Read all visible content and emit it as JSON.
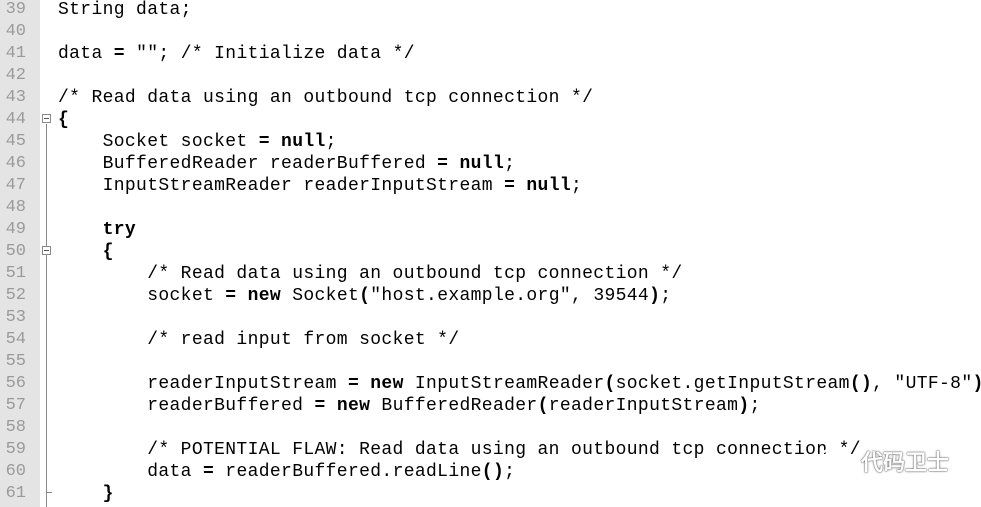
{
  "editor": {
    "lines": [
      {
        "num": "39",
        "segments": [
          {
            "t": "String data;",
            "c": "tx"
          }
        ]
      },
      {
        "num": "40",
        "segments": []
      },
      {
        "num": "41",
        "segments": [
          {
            "t": "data ",
            "c": "tx"
          },
          {
            "t": "=",
            "c": "op"
          },
          {
            "t": " \"\"; ",
            "c": "tx"
          },
          {
            "t": "/* Initialize data */",
            "c": "cm"
          }
        ]
      },
      {
        "num": "42",
        "segments": []
      },
      {
        "num": "43",
        "segments": [
          {
            "t": "/* Read data using an outbound tcp connection */",
            "c": "cm"
          }
        ]
      },
      {
        "num": "44",
        "segments": [
          {
            "t": "{",
            "c": "op"
          }
        ]
      },
      {
        "num": "45",
        "segments": [
          {
            "t": "    Socket socket ",
            "c": "tx"
          },
          {
            "t": "=",
            "c": "op"
          },
          {
            "t": " ",
            "c": "tx"
          },
          {
            "t": "null",
            "c": "kw"
          },
          {
            "t": ";",
            "c": "tx"
          }
        ]
      },
      {
        "num": "46",
        "segments": [
          {
            "t": "    BufferedReader readerBuffered ",
            "c": "tx"
          },
          {
            "t": "=",
            "c": "op"
          },
          {
            "t": " ",
            "c": "tx"
          },
          {
            "t": "null",
            "c": "kw"
          },
          {
            "t": ";",
            "c": "tx"
          }
        ]
      },
      {
        "num": "47",
        "segments": [
          {
            "t": "    InputStreamReader readerInputStream ",
            "c": "tx"
          },
          {
            "t": "=",
            "c": "op"
          },
          {
            "t": " ",
            "c": "tx"
          },
          {
            "t": "null",
            "c": "kw"
          },
          {
            "t": ";",
            "c": "tx"
          }
        ]
      },
      {
        "num": "48",
        "segments": []
      },
      {
        "num": "49",
        "segments": [
          {
            "t": "    ",
            "c": "tx"
          },
          {
            "t": "try",
            "c": "kw"
          }
        ]
      },
      {
        "num": "50",
        "segments": [
          {
            "t": "    ",
            "c": "tx"
          },
          {
            "t": "{",
            "c": "op"
          }
        ]
      },
      {
        "num": "51",
        "segments": [
          {
            "t": "        ",
            "c": "tx"
          },
          {
            "t": "/* Read data using an outbound tcp connection */",
            "c": "cm"
          }
        ]
      },
      {
        "num": "52",
        "segments": [
          {
            "t": "        socket ",
            "c": "tx"
          },
          {
            "t": "=",
            "c": "op"
          },
          {
            "t": " ",
            "c": "tx"
          },
          {
            "t": "new",
            "c": "kw"
          },
          {
            "t": " Socket",
            "c": "tx"
          },
          {
            "t": "(",
            "c": "op"
          },
          {
            "t": "\"host.example.org\", 39544",
            "c": "str"
          },
          {
            "t": ")",
            "c": "op"
          },
          {
            "t": ";",
            "c": "tx"
          }
        ]
      },
      {
        "num": "53",
        "segments": []
      },
      {
        "num": "54",
        "segments": [
          {
            "t": "        ",
            "c": "tx"
          },
          {
            "t": "/* read input from socket */",
            "c": "cm"
          }
        ]
      },
      {
        "num": "55",
        "segments": []
      },
      {
        "num": "56",
        "segments": [
          {
            "t": "        readerInputStream ",
            "c": "tx"
          },
          {
            "t": "=",
            "c": "op"
          },
          {
            "t": " ",
            "c": "tx"
          },
          {
            "t": "new",
            "c": "kw"
          },
          {
            "t": " InputStreamReader",
            "c": "tx"
          },
          {
            "t": "(",
            "c": "op"
          },
          {
            "t": "socket.getInputStream",
            "c": "tx"
          },
          {
            "t": "()",
            "c": "op"
          },
          {
            "t": ", \"UTF-8\"",
            "c": "str"
          },
          {
            "t": ")",
            "c": "op"
          },
          {
            "t": ";",
            "c": "tx"
          }
        ]
      },
      {
        "num": "57",
        "segments": [
          {
            "t": "        readerBuffered ",
            "c": "tx"
          },
          {
            "t": "=",
            "c": "op"
          },
          {
            "t": " ",
            "c": "tx"
          },
          {
            "t": "new",
            "c": "kw"
          },
          {
            "t": " BufferedReader",
            "c": "tx"
          },
          {
            "t": "(",
            "c": "op"
          },
          {
            "t": "readerInputStream",
            "c": "tx"
          },
          {
            "t": ")",
            "c": "op"
          },
          {
            "t": ";",
            "c": "tx"
          }
        ]
      },
      {
        "num": "58",
        "segments": []
      },
      {
        "num": "59",
        "segments": [
          {
            "t": "        ",
            "c": "tx"
          },
          {
            "t": "/* POTENTIAL FLAW: Read data using an outbound tcp connection */",
            "c": "cm"
          }
        ]
      },
      {
        "num": "60",
        "segments": [
          {
            "t": "        data ",
            "c": "tx"
          },
          {
            "t": "=",
            "c": "op"
          },
          {
            "t": " readerBuffered.readLine",
            "c": "tx"
          },
          {
            "t": "()",
            "c": "op"
          },
          {
            "t": ";",
            "c": "tx"
          }
        ]
      },
      {
        "num": "61",
        "segments": [
          {
            "t": "    ",
            "c": "tx"
          },
          {
            "t": "}",
            "c": "op"
          }
        ]
      }
    ],
    "fold_markers": [
      "44",
      "50"
    ]
  },
  "watermark": {
    "icon": "wechat-icon",
    "text": "代码卫士"
  },
  "colors": {
    "gutter_bg": "#e4e4e4",
    "line_number": "#9a9a9a",
    "code_text": "#000000",
    "background": "#ffffff"
  }
}
